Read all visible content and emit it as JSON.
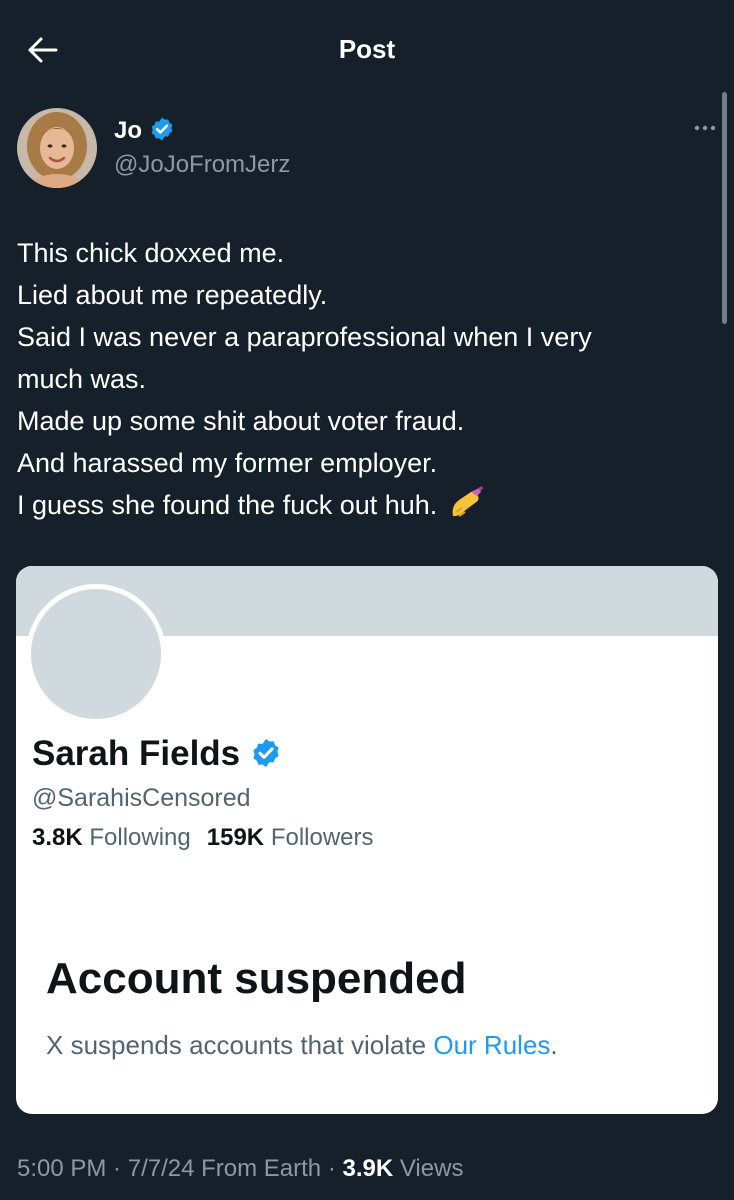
{
  "header": {
    "title": "Post",
    "back_icon": "arrow-left-icon"
  },
  "author": {
    "name": "Jo",
    "handle": "@JoJoFromJerz",
    "verified_icon": "verified-badge-icon",
    "avatar_icon": "user-avatar"
  },
  "tweet": {
    "lines": [
      "This chick doxxed me.",
      "Lied about me repeatedly.",
      "Said I was never a paraprofessional when I very",
      "much was.",
      "Made up some shit about voter fraud.",
      "And harassed my former employer.",
      "I guess she found the fuck out huh."
    ],
    "emoji": "nail-polish-emoji"
  },
  "card": {
    "name": "Sarah Fields",
    "handle": "@SarahisCensored",
    "following_count": "3.8K",
    "following_label": "Following",
    "followers_count": "159K",
    "followers_label": "Followers",
    "suspended_title": "Account suspended",
    "suspended_text": "X suspends accounts that violate ",
    "rules_link": "Our Rules",
    "rules_suffix": "."
  },
  "meta": {
    "time": "5:00 PM",
    "sep1": " · ",
    "date": "7/7/24",
    "source": " From Earth",
    "sep2": " · ",
    "views_count": "3.9K",
    "views_label": " Views"
  },
  "colors": {
    "background": "#15202b",
    "accent": "#1d9bf0",
    "muted": "#8b98a5"
  }
}
